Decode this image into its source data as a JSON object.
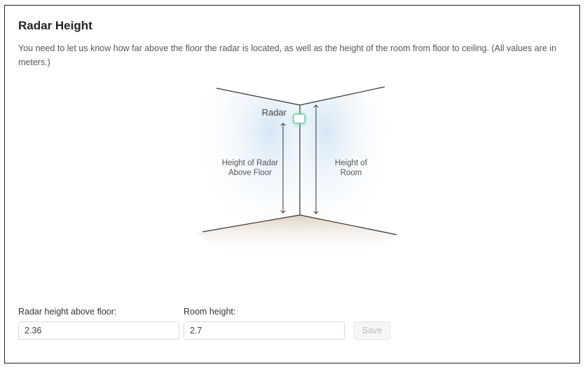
{
  "panel": {
    "title": "Radar Height",
    "description": "You need to let us know how far above the floor the radar is located, as well as the height of the room from floor to ceiling. (All values are in meters.)"
  },
  "diagram": {
    "radar_label": "Radar",
    "radar_height_label_line1": "Height of Radar",
    "radar_height_label_line2": "Above Floor",
    "room_height_label_line1": "Height of",
    "room_height_label_line2": "Room"
  },
  "form": {
    "radar_height_label": "Radar height above floor:",
    "radar_height_value": "2.36",
    "room_height_label": "Room height:",
    "room_height_value": "2.7",
    "save_label": "Save"
  },
  "colors": {
    "wall_tint": "#e3eef7",
    "radar_glow": "#7fd3b4",
    "floor_tint": "#e8ddd0",
    "save_disabled_text": "#b9b9b9"
  }
}
